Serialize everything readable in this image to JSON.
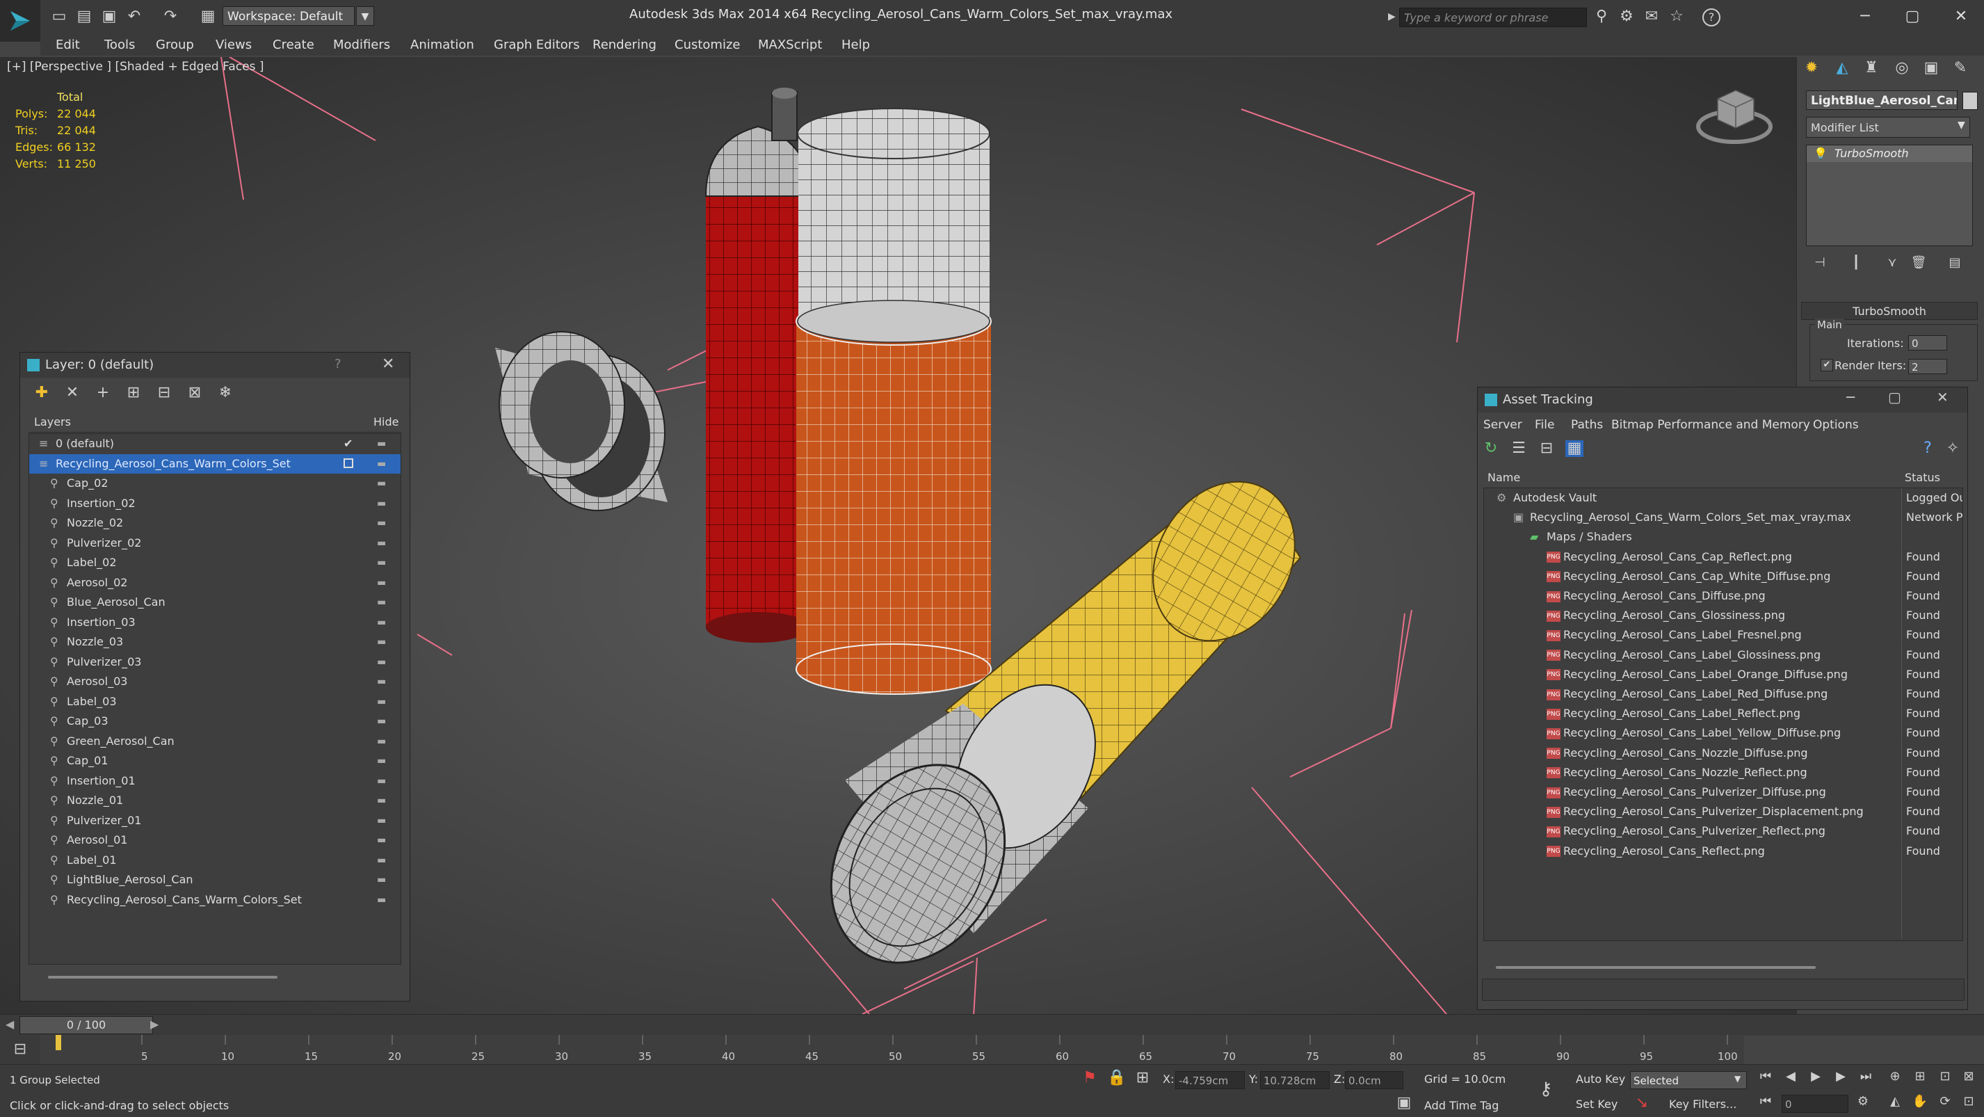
{
  "titlebar": {
    "workspace_label": "Workspace: Default",
    "app_title": "Autodesk 3ds Max  2014 x64      Recycling_Aerosol_Cans_Warm_Colors_Set_max_vray.max",
    "search_placeholder": "Type a keyword or phrase",
    "help_label": "?"
  },
  "menu": [
    "Edit",
    "Tools",
    "Group",
    "Views",
    "Create",
    "Modifiers",
    "Animation",
    "Graph Editors",
    "Rendering",
    "Customize",
    "MAXScript",
    "Help"
  ],
  "viewport": {
    "label": "[+] [Perspective ] [Shaded + Edged Faces ]",
    "stats_header": "Total",
    "stats": [
      {
        "label": "Polys:",
        "value": "22 044"
      },
      {
        "label": "Tris:",
        "value": "22 044"
      },
      {
        "label": "Edges:",
        "value": "66 132"
      },
      {
        "label": "Verts:",
        "value": "11 250"
      }
    ]
  },
  "command_panel": {
    "object_name": "LightBlue_Aerosol_Can",
    "modifier_list": "Modifier List",
    "stack_item": "TurboSmooth",
    "rollout_title": "TurboSmooth",
    "group_main": "Main",
    "iterations_label": "Iterations:",
    "iterations_value": "0",
    "render_iters_label": "Render Iters:",
    "render_iters_value": "2"
  },
  "layer_panel": {
    "title": "Layer: 0 (default)",
    "help": "?",
    "col_layers": "Layers",
    "col_hide": "Hide",
    "rows": [
      {
        "label": "0 (default)",
        "level": 1
      },
      {
        "label": "Recycling_Aerosol_Cans_Warm_Colors_Set",
        "level": 1
      },
      {
        "label": "Cap_02",
        "level": 2
      },
      {
        "label": "Insertion_02",
        "level": 2
      },
      {
        "label": "Nozzle_02",
        "level": 2
      },
      {
        "label": "Pulverizer_02",
        "level": 2
      },
      {
        "label": "Label_02",
        "level": 2
      },
      {
        "label": "Aerosol_02",
        "level": 2
      },
      {
        "label": "Blue_Aerosol_Can",
        "level": 2
      },
      {
        "label": "Insertion_03",
        "level": 2
      },
      {
        "label": "Nozzle_03",
        "level": 2
      },
      {
        "label": "Pulverizer_03",
        "level": 2
      },
      {
        "label": "Aerosol_03",
        "level": 2
      },
      {
        "label": "Label_03",
        "level": 2
      },
      {
        "label": "Cap_03",
        "level": 2
      },
      {
        "label": "Green_Aerosol_Can",
        "level": 2
      },
      {
        "label": "Cap_01",
        "level": 2
      },
      {
        "label": "Insertion_01",
        "level": 2
      },
      {
        "label": "Nozzle_01",
        "level": 2
      },
      {
        "label": "Pulverizer_01",
        "level": 2
      },
      {
        "label": "Aerosol_01",
        "level": 2
      },
      {
        "label": "Label_01",
        "level": 2
      },
      {
        "label": "LightBlue_Aerosol_Can",
        "level": 2
      },
      {
        "label": "Recycling_Aerosol_Cans_Warm_Colors_Set",
        "level": 2
      }
    ]
  },
  "asset_panel": {
    "title": "Asset Tracking",
    "menu": [
      "Server",
      "File",
      "Paths",
      "Bitmap Performance and Memory",
      "Options"
    ],
    "col_name": "Name",
    "col_status": "Status",
    "vault": {
      "label": "Autodesk Vault",
      "status": "Logged Ou"
    },
    "file": {
      "label": "Recycling_Aerosol_Cans_Warm_Colors_Set_max_vray.max",
      "status": "Network Pa"
    },
    "maps": {
      "label": "Maps / Shaders"
    },
    "png_badge": "PNG",
    "textures": [
      {
        "name": "Recycling_Aerosol_Cans_Cap_Reflect.png",
        "status": "Found"
      },
      {
        "name": "Recycling_Aerosol_Cans_Cap_White_Diffuse.png",
        "status": "Found"
      },
      {
        "name": "Recycling_Aerosol_Cans_Diffuse.png",
        "status": "Found"
      },
      {
        "name": "Recycling_Aerosol_Cans_Glossiness.png",
        "status": "Found"
      },
      {
        "name": "Recycling_Aerosol_Cans_Label_Fresnel.png",
        "status": "Found"
      },
      {
        "name": "Recycling_Aerosol_Cans_Label_Glossiness.png",
        "status": "Found"
      },
      {
        "name": "Recycling_Aerosol_Cans_Label_Orange_Diffuse.png",
        "status": "Found"
      },
      {
        "name": "Recycling_Aerosol_Cans_Label_Red_Diffuse.png",
        "status": "Found"
      },
      {
        "name": "Recycling_Aerosol_Cans_Label_Reflect.png",
        "status": "Found"
      },
      {
        "name": "Recycling_Aerosol_Cans_Label_Yellow_Diffuse.png",
        "status": "Found"
      },
      {
        "name": "Recycling_Aerosol_Cans_Nozzle_Diffuse.png",
        "status": "Found"
      },
      {
        "name": "Recycling_Aerosol_Cans_Nozzle_Reflect.png",
        "status": "Found"
      },
      {
        "name": "Recycling_Aerosol_Cans_Pulverizer_Diffuse.png",
        "status": "Found"
      },
      {
        "name": "Recycling_Aerosol_Cans_Pulverizer_Displacement.png",
        "status": "Found"
      },
      {
        "name": "Recycling_Aerosol_Cans_Pulverizer_Reflect.png",
        "status": "Found"
      },
      {
        "name": "Recycling_Aerosol_Cans_Reflect.png",
        "status": "Found"
      }
    ]
  },
  "timeline": {
    "frame_label": "0 / 100",
    "ticks": [
      "5",
      "10",
      "15",
      "20",
      "25",
      "30",
      "35",
      "40",
      "45",
      "50",
      "55",
      "60",
      "65",
      "70",
      "75",
      "80",
      "85",
      "90",
      "95",
      "100"
    ]
  },
  "status": {
    "selection": "1 Group Selected",
    "prompt": "Click or click-and-drag to select objects",
    "x_label": "X:",
    "x_value": "-4.759cm",
    "y_label": "Y:",
    "y_value": "10.728cm",
    "z_label": "Z:",
    "z_value": "0.0cm",
    "grid": "Grid = 10.0cm",
    "add_time_tag": "Add Time Tag",
    "auto_key": "Auto Key",
    "selected": "Selected",
    "set_key": "Set Key",
    "key_filters": "Key Filters...",
    "frame_value": "0"
  },
  "colors": {
    "accent_select": "#2c67b9",
    "can_red": "#b01010",
    "can_orange": "#c8561c",
    "can_yellow": "#e6c23e",
    "stats_text": "#f0d020"
  }
}
